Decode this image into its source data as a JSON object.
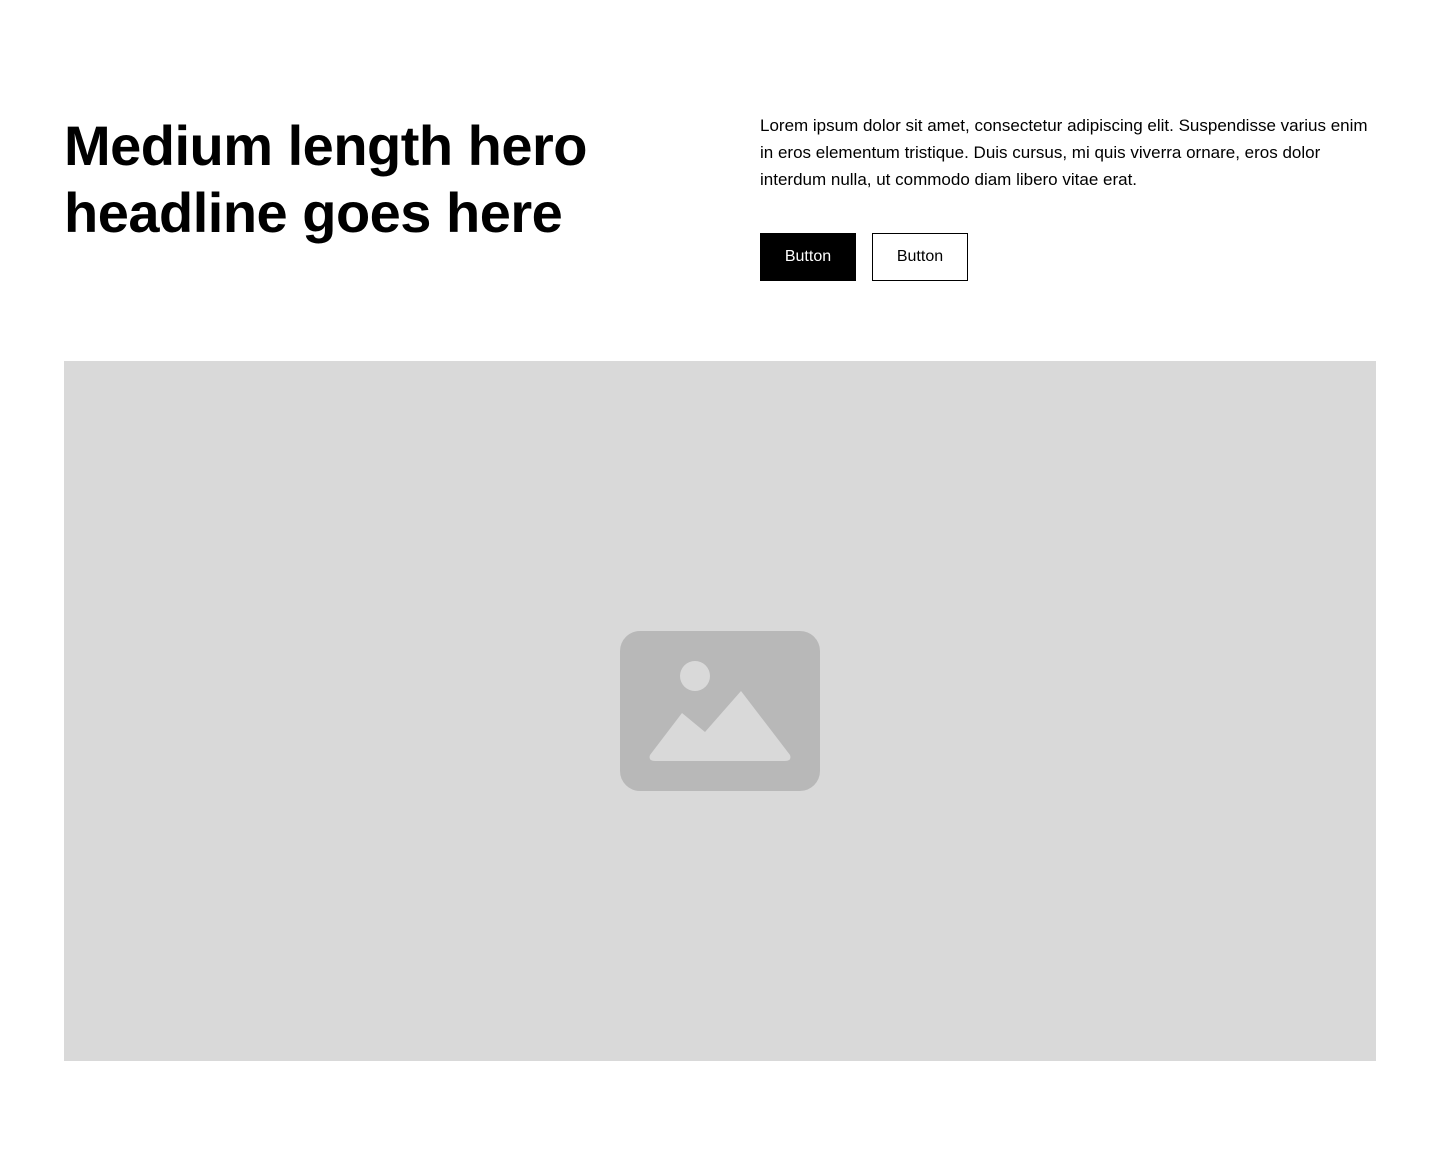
{
  "hero": {
    "headline": "Medium length hero headline goes here",
    "description": "Lorem ipsum dolor sit amet, consectetur adipiscing elit. Suspendisse varius enim in eros elementum tristique. Duis cursus, mi quis viverra ornare, eros dolor interdum nulla, ut commodo diam libero vitae erat.",
    "primary_button_label": "Button",
    "secondary_button_label": "Button"
  },
  "image": {
    "icon": "image-placeholder-icon",
    "background_color": "#d9d9d9",
    "icon_color": "#b8b8b8"
  },
  "colors": {
    "primary": "#000000",
    "background": "#ffffff"
  }
}
